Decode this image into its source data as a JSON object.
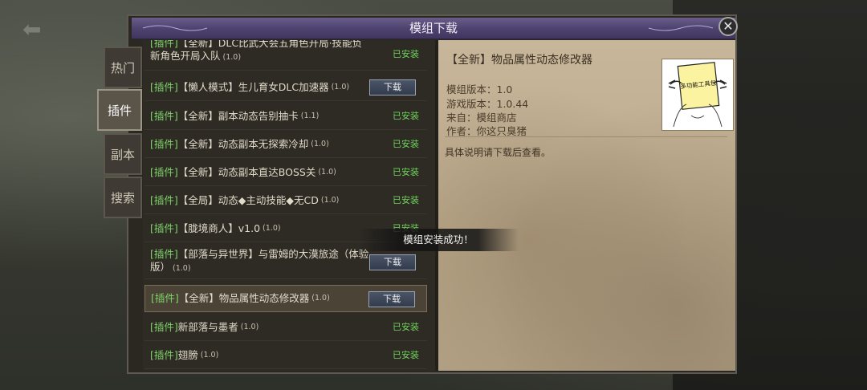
{
  "window": {
    "title": "模组下载"
  },
  "tabs": [
    {
      "label": "热门",
      "active": false
    },
    {
      "label": "插件",
      "active": true
    },
    {
      "label": "副本",
      "active": false
    },
    {
      "label": "搜索",
      "active": false
    }
  ],
  "mod_list": [
    {
      "tag": "[插件]",
      "name_line1": "【全新】DLC比武大会五角色开局·技能负",
      "name_line2": "新角色开局入队",
      "version": "(1.0)",
      "status": "已安装",
      "action": null
    },
    {
      "tag": "[插件]",
      "name": "【懒人模式】生儿育女DLC加速器",
      "version": "(1.0)",
      "status": null,
      "action": "下载"
    },
    {
      "tag": "[插件]",
      "name": "【全新】副本动态告别抽卡",
      "version": "(1.1)",
      "status": "已安装",
      "action": null
    },
    {
      "tag": "[插件]",
      "name": "【全新】动态副本无探索冷却",
      "version": "(1.0)",
      "status": "已安装",
      "action": null
    },
    {
      "tag": "[插件]",
      "name": "【全新】动态副本直达BOSS关",
      "version": "(1.0)",
      "status": "已安装",
      "action": null
    },
    {
      "tag": "[插件]",
      "name": "【全局】动态◆主动技能◆无CD",
      "version": "(1.0)",
      "status": "已安装",
      "action": null
    },
    {
      "tag": "[插件]",
      "name": "【胧境商人】v1.0",
      "version": "(1.0)",
      "status": "已安装",
      "action": null
    },
    {
      "tag": "[插件]",
      "name_line1": "【部落与异世界】与雷姆的大漠旅途（体验",
      "name_line2": "版）",
      "version": "(1.0)",
      "status": null,
      "action": "下载"
    },
    {
      "tag": "[插件]",
      "name": "【全新】物品属性动态修改器",
      "version": "(1.0)",
      "status": null,
      "action": "下载",
      "selected": true
    },
    {
      "tag": "[插件]",
      "name": "新部落与墨者",
      "version": "(1.0)",
      "status": "已安装",
      "action": null
    },
    {
      "tag": "[插件]",
      "name": "翅膀",
      "version": "(1.0)",
      "status": "已安装",
      "action": null
    }
  ],
  "detail": {
    "title": "【全新】物品属性动态修改器",
    "mod_version": "模组版本：1.0",
    "game_version": "游戏版本：1.0.44",
    "source": "来自：模组商店",
    "author": "作者：你这只臭猪",
    "description": "具体说明请下载后查看。",
    "thumb_text": "多功能工具包"
  },
  "toast": "模组安装成功！",
  "close_icon": "close-icon",
  "colors": {
    "tag": "#7fd46a",
    "installed": "#6fd45e",
    "title_bar": "#4f4470"
  }
}
